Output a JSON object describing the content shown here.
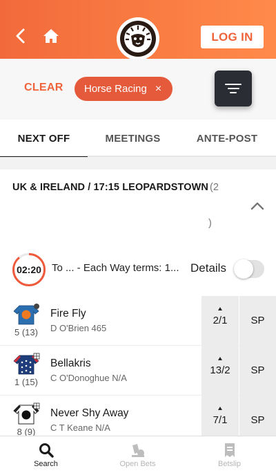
{
  "header": {
    "login_label": "LOG IN",
    "brand_color": "#f26a3b"
  },
  "filters": {
    "clear_label": "CLEAR",
    "chip_label": "Horse Racing",
    "chip_close": "×"
  },
  "tabs": [
    {
      "label": "NEXT OFF",
      "active": true
    },
    {
      "label": "MEETINGS",
      "active": false
    },
    {
      "label": "ANTE-POST",
      "active": false
    }
  ],
  "race": {
    "title": "UK & IRELAND / 17:15 LEOPARDSTOWN",
    "count_open": "(2",
    "count_close": ")",
    "timer": "02:20",
    "terms": "To ...  - Each Way terms: 1...",
    "details_label": "Details",
    "details_on": false
  },
  "runners": [
    {
      "name": "Fire Fly",
      "jockey": "D O'Brien  465",
      "saddle": "5 (13)",
      "odds": "2/1",
      "sp": "SP",
      "silk": "blue-orange"
    },
    {
      "name": "Bellakris",
      "jockey": "C O'Donoghue  N/A",
      "saddle": "1 (15)",
      "odds": "13/2",
      "sp": "SP",
      "silk": "navy-red-stars"
    },
    {
      "name": "Never Shy Away",
      "jockey": "C T Keane  N/A",
      "saddle": "8 (9)",
      "odds": "7/1",
      "sp": "SP",
      "silk": "white-black"
    }
  ],
  "bottom_nav": [
    {
      "label": "Search",
      "icon": "search-icon",
      "active": true
    },
    {
      "label": "Open Bets",
      "icon": "open-bets-icon",
      "active": false
    },
    {
      "label": "Betslip",
      "icon": "betslip-icon",
      "active": false
    }
  ]
}
